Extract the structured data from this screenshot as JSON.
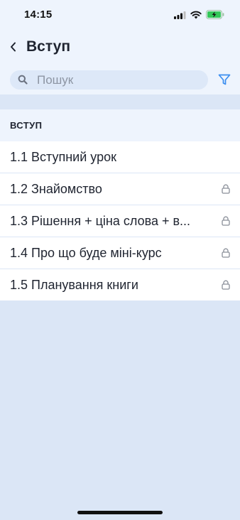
{
  "status_bar": {
    "time": "14:15"
  },
  "nav": {
    "title": "Вступ"
  },
  "search": {
    "placeholder": "Пошук",
    "value": ""
  },
  "section": {
    "label": "ВСТУП"
  },
  "lessons": [
    {
      "label": "1.1 Вступний урок",
      "locked": false
    },
    {
      "label": "1.2 Знайомство",
      "locked": true
    },
    {
      "label": "1.3 Рішення + ціна слова + в...",
      "locked": true
    },
    {
      "label": "1.4 Про що буде міні-курс",
      "locked": true
    },
    {
      "label": "1.5 Планування книги",
      "locked": true
    }
  ],
  "colors": {
    "accent": "#3b8ef0",
    "header_bg": "#eef4fd",
    "page_bg": "#dbe6f6",
    "battery": "#34c759"
  }
}
